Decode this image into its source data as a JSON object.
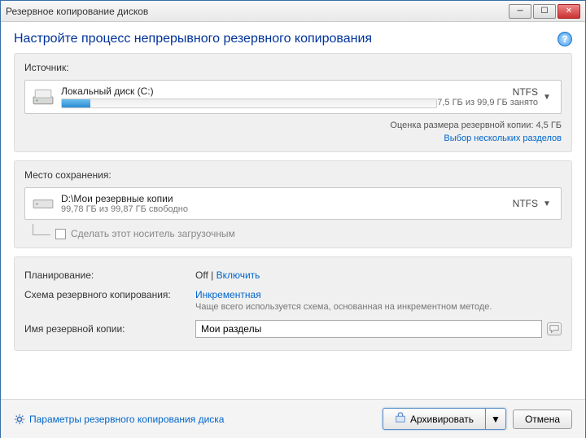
{
  "window": {
    "title": "Резервное копирование дисков"
  },
  "header": {
    "title": "Настройте процесс непрерывного резервного копирования"
  },
  "source": {
    "label": "Источник:",
    "drive_name": "Локальный диск (C:)",
    "fs": "NTFS",
    "usage_text": "7,5 ГБ из 99,9 ГБ занято",
    "usage_percent": 7.5,
    "estimate": "Оценка размера резервной копии: 4,5 ГБ",
    "multi_link": "Выбор нескольких разделов"
  },
  "destination": {
    "label": "Место сохранения:",
    "path": "D:\\Мои резервные копии",
    "free_text": "99,78 ГБ из 99,87 ГБ свободно",
    "fs": "NTFS",
    "bootable_label": "Сделать этот носитель загрузочным"
  },
  "settings": {
    "schedule_label": "Планирование:",
    "schedule_value": "Off",
    "schedule_sep": " | ",
    "schedule_link": "Включить",
    "scheme_label": "Схема резервного копирования:",
    "scheme_link": "Инкрементная",
    "scheme_hint": "Чаще всего используется схема, основанная на инкрементном методе.",
    "name_label": "Имя резервной копии:",
    "name_value": "Мои разделы"
  },
  "footer": {
    "options_link": "Параметры резервного копирования диска",
    "archive_btn": "Архивировать",
    "cancel_btn": "Отмена"
  }
}
